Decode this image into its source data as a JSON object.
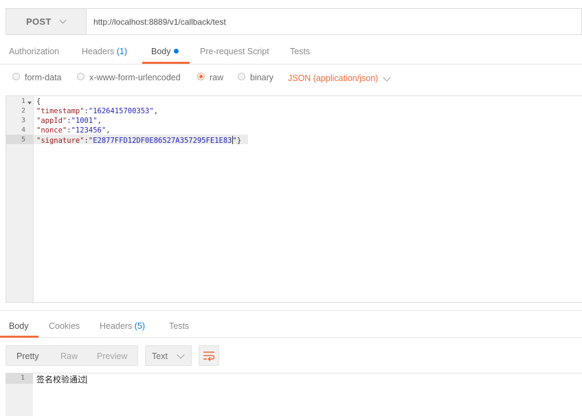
{
  "request": {
    "method": "POST",
    "url": "http://localhost:8889/v1/callback/test"
  },
  "request_tabs": {
    "authorization": "Authorization",
    "headers": "Headers",
    "headers_count": "(1)",
    "body": "Body",
    "prerequest": "Pre-request Script",
    "tests": "Tests"
  },
  "body_types": {
    "form_data": "form-data",
    "urlencoded": "x-www-form-urlencoded",
    "raw": "raw",
    "binary": "binary",
    "content_type": "JSON (application/json)",
    "selected": "raw"
  },
  "editor": {
    "line_numbers": [
      "1",
      "2",
      "3",
      "4",
      "5"
    ],
    "open_brace": "{",
    "lines": [
      {
        "key": "\"timestamp\"",
        "value": "\"1626415700353\"",
        "tail": ","
      },
      {
        "key": "\"appId\"",
        "value": "\"1001\"",
        "tail": ","
      },
      {
        "key": "\"nonce\"",
        "value": "\"123456\"",
        "tail": ","
      },
      {
        "key": "\"signature\"",
        "value": "\"E2877FFD12DF0E86527A357295FE1E83",
        "quote": "\"",
        "tail": "}"
      }
    ]
  },
  "response_tabs": {
    "body": "Body",
    "cookies": "Cookies",
    "headers": "Headers",
    "headers_count": "(5)",
    "tests": "Tests"
  },
  "response_view": {
    "pretty": "Pretty",
    "raw": "Raw",
    "preview": "Preview",
    "format": "Text",
    "wrap_icon": "wrap-lines-icon"
  },
  "response_body": {
    "line_number": "1",
    "text": "签名校验通过"
  },
  "colors": {
    "accent": "#f26b3a",
    "link_blue": "#097bed",
    "json_key": "#a11d1d",
    "json_string": "#2525c0"
  }
}
